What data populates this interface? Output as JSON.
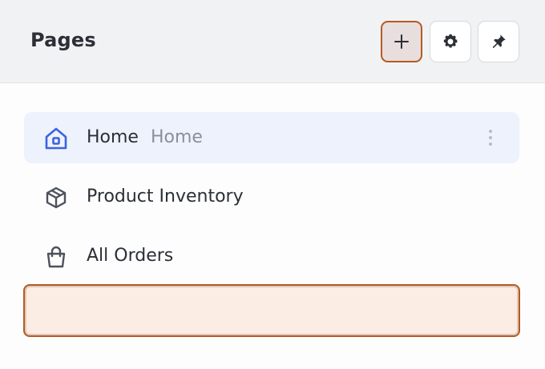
{
  "header": {
    "title": "Pages",
    "buttons": {
      "add": {
        "icon": "plus-icon"
      },
      "settings": {
        "icon": "gear-icon"
      },
      "pin": {
        "icon": "pin-icon"
      }
    }
  },
  "pages": [
    {
      "label": "Home",
      "sublabel": "Home",
      "icon": "home-icon",
      "active": true
    },
    {
      "label": "Product Inventory",
      "icon": "box-icon"
    },
    {
      "label": "All Orders",
      "icon": "shopping-bag-icon"
    }
  ],
  "new_page_input": {
    "value": "",
    "placeholder": ""
  },
  "colors": {
    "accent": "#b55a22",
    "active_bg": "#edf2fd",
    "home_icon": "#3d63dd",
    "header_bg": "#f1f2f4"
  }
}
